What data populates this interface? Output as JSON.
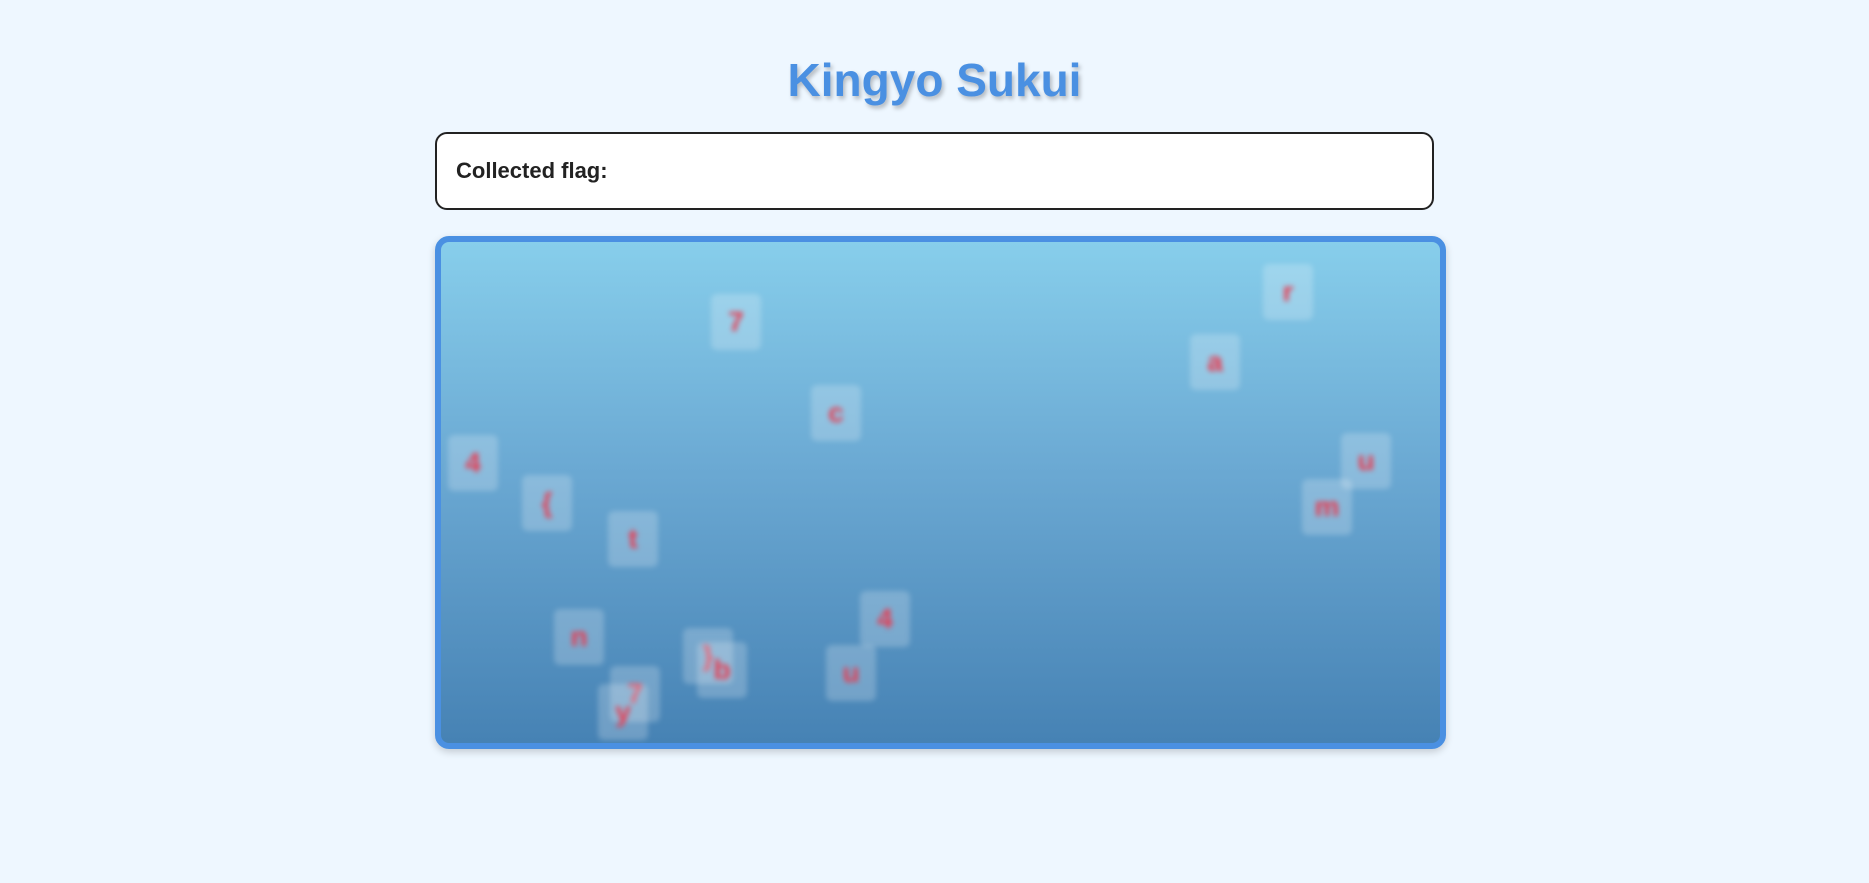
{
  "page": {
    "title": "Kingyo Sukui"
  },
  "flag": {
    "label": "Collected flag:",
    "value": ""
  },
  "colors": {
    "background": "#eef7ff",
    "title": "#4a90e2",
    "tank_border": "#4a90e2",
    "water_top": "#87ceeb",
    "water_bottom": "#4682b4",
    "fish_text": "#e83a4f"
  },
  "fish": [
    {
      "char": "r"
    },
    {
      "char": "7"
    },
    {
      "char": "a"
    },
    {
      "char": "c"
    },
    {
      "char": "4"
    },
    {
      "char": "u"
    },
    {
      "char": "{"
    },
    {
      "char": "m"
    },
    {
      "char": "t"
    },
    {
      "char": "4"
    },
    {
      "char": "n"
    },
    {
      "char": "}"
    },
    {
      "char": "b"
    },
    {
      "char": "u"
    },
    {
      "char": "7"
    },
    {
      "char": "y"
    }
  ]
}
